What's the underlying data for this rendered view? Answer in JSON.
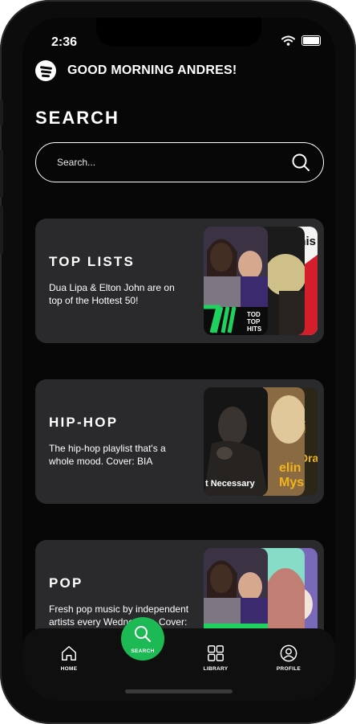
{
  "status": {
    "time": "2:36"
  },
  "header": {
    "greeting": "GOOD MORNING ANDRES!"
  },
  "page": {
    "title": "SEARCH"
  },
  "search": {
    "placeholder": "Search..."
  },
  "categories": [
    {
      "title": "TOP LISTS",
      "description": "Dua Lipa & Elton John are on top of the Hottest 50!",
      "art_text": [
        "TOD",
        "TOP",
        "HITS",
        "This"
      ]
    },
    {
      "title": "HIP-HOP",
      "description": "The hip-hop playlist that's a whole mood. Cover: BIA",
      "art_text": [
        "t Necessary",
        "elin",
        "Mys",
        "avi",
        "Dra"
      ]
    },
    {
      "title": "POP",
      "description": "Fresh pop music by independent artists every Wednesday. Cover: Haley"
    }
  ],
  "nav": [
    {
      "label": "HOME",
      "icon": "home-icon"
    },
    {
      "label": "SEARCH",
      "icon": "search-icon",
      "active": true
    },
    {
      "label": "LIBRARY",
      "icon": "library-icon"
    },
    {
      "label": "PROFILE",
      "icon": "profile-icon"
    }
  ],
  "colors": {
    "accent": "#1DB954",
    "background": "#070707",
    "card": "#2A2A2D"
  }
}
